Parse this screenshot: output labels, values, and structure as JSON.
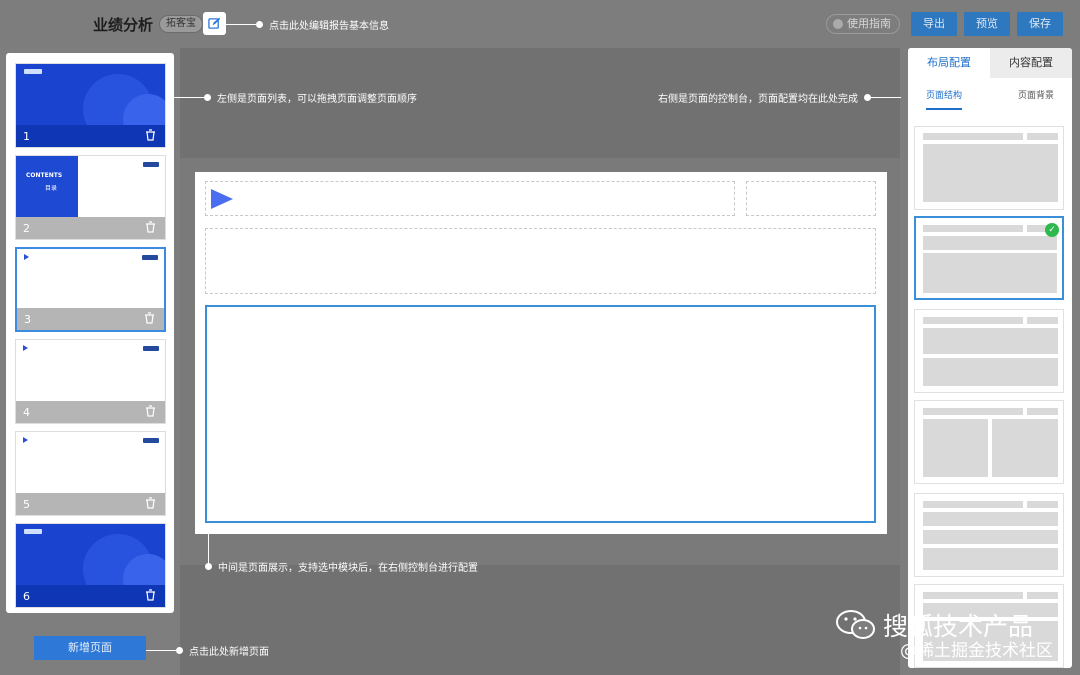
{
  "header": {
    "title": "业绩分析",
    "tag": "拓客宝",
    "edit_hint": "点击此处编辑报告基本信息",
    "guide": "使用指南",
    "buttons": {
      "export": "导出",
      "preview": "预览",
      "save": "保存"
    },
    "accent": "#2e78c0"
  },
  "page_list": {
    "hint": "左侧是页面列表，可以拖拽页面调整页面顺序",
    "pages": [
      {
        "number": "1"
      },
      {
        "number": "2",
        "contents_title": "CONTENTS",
        "contents_sub": "目录"
      },
      {
        "number": "3"
      },
      {
        "number": "4"
      },
      {
        "number": "5"
      },
      {
        "number": "6"
      }
    ],
    "add_button": "新增页面",
    "add_hint": "点击此处新增页面"
  },
  "canvas": {
    "hint": "中间是页面展示，支持选中模块后，在右侧控制台进行配置"
  },
  "right_panel": {
    "hint": "右侧是页面的控制台，页面配置均在此处完成",
    "tabs": {
      "layout": "布局配置",
      "content": "内容配置"
    },
    "subtabs": {
      "structure": "页面结构",
      "background": "页面背景"
    },
    "selected_check": "✓"
  },
  "watermark": {
    "name": "搜狐技术产品",
    "sub": "@稀土掘金技术社区"
  }
}
